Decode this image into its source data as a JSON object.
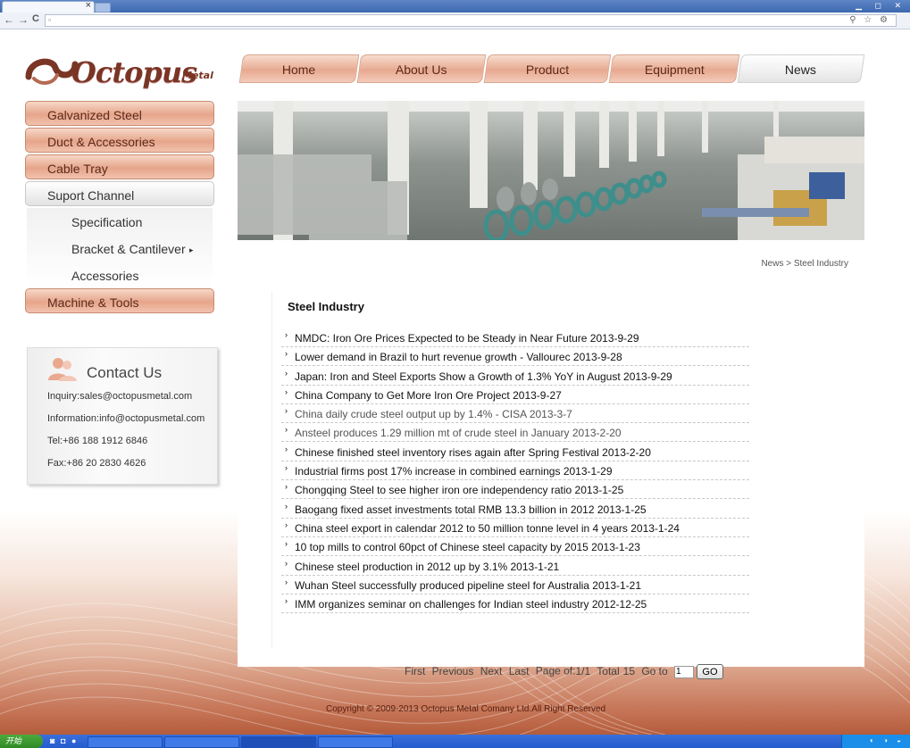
{
  "browser": {
    "tab_close": "×",
    "nav_back": "←",
    "nav_forward": "→",
    "nav_reload": "C",
    "address": ""
  },
  "logo": {
    "text": "Octopus",
    "sub": "Metal"
  },
  "topnav": [
    "Home",
    "About Us",
    "Product",
    "Equipment",
    "News"
  ],
  "sidemenu": {
    "items": [
      "Galvanized Steel",
      "Duct & Accessories",
      "Cable Tray",
      "Suport Channel"
    ],
    "submenu": [
      "Specification",
      "Bracket & Cantilever",
      "Accessories"
    ],
    "submenu_arrow": "▸",
    "last": "Machine & Tools"
  },
  "contact": {
    "title": "Contact Us",
    "inquiry": "Inquiry:sales@octopusmetal.com",
    "information": "Information:info@octopusmetal.com",
    "tel": "Tel:+86 188 1912 6846",
    "fax": "Fax:+86 20 2830 4626"
  },
  "breadcrumb": "News > Steel Industry",
  "content_title": "Steel Industry",
  "news_arrow": "›",
  "news": [
    "NMDC: Iron Ore Prices Expected to be Steady in Near Future 2013-9-29",
    "Lower demand in Brazil to hurt revenue growth - Vallourec 2013-9-28",
    "Japan: Iron and Steel Exports Show a Growth of 1.3% YoY in August 2013-9-29",
    "China Company to Get More Iron Ore Project 2013-9-27",
    "China daily crude steel output up by 1.4% - CISA 2013-3-7",
    "Ansteel produces 1.29 million mt of crude steel in January 2013-2-20",
    "Chinese finished steel inventory rises again after Spring Festival 2013-2-20",
    "Industrial firms post 17% increase in combined earnings 2013-1-29",
    "Chongqing Steel to see higher iron ore independency ratio 2013-1-25",
    "Baogang fixed asset investments total RMB 13.3 billion in 2012 2013-1-25",
    "China steel export in calendar 2012 to 50 million tonne level in 4 years 2013-1-24",
    "10 top mills to control 60pct of Chinese steel capacity by 2015 2013-1-23",
    "Chinese steel production in 2012 up by 3.1% 2013-1-21",
    "Wuhan Steel successfully produced pipeline steel for Australia 2013-1-21",
    "IMM organizes seminar on challenges for Indian steel industry 2012-12-25"
  ],
  "pager": {
    "first": "First",
    "previous": "Previous",
    "next": "Next",
    "last": "Last",
    "page_label": "Page of:",
    "page_value": "1/1",
    "total_label": "Total",
    "total_value": "15",
    "goto_label": "Go to",
    "input_value": "1",
    "go_button": "GO"
  },
  "copyright": "Copyright © 2009-2013 Octopus Metal Comany Ltd.All Right Reserved",
  "taskbar": {
    "start": "开始"
  },
  "colors": {
    "brand": "#7a3525",
    "menu_copper": "#e6a58a",
    "footer": "#b45c3c"
  }
}
